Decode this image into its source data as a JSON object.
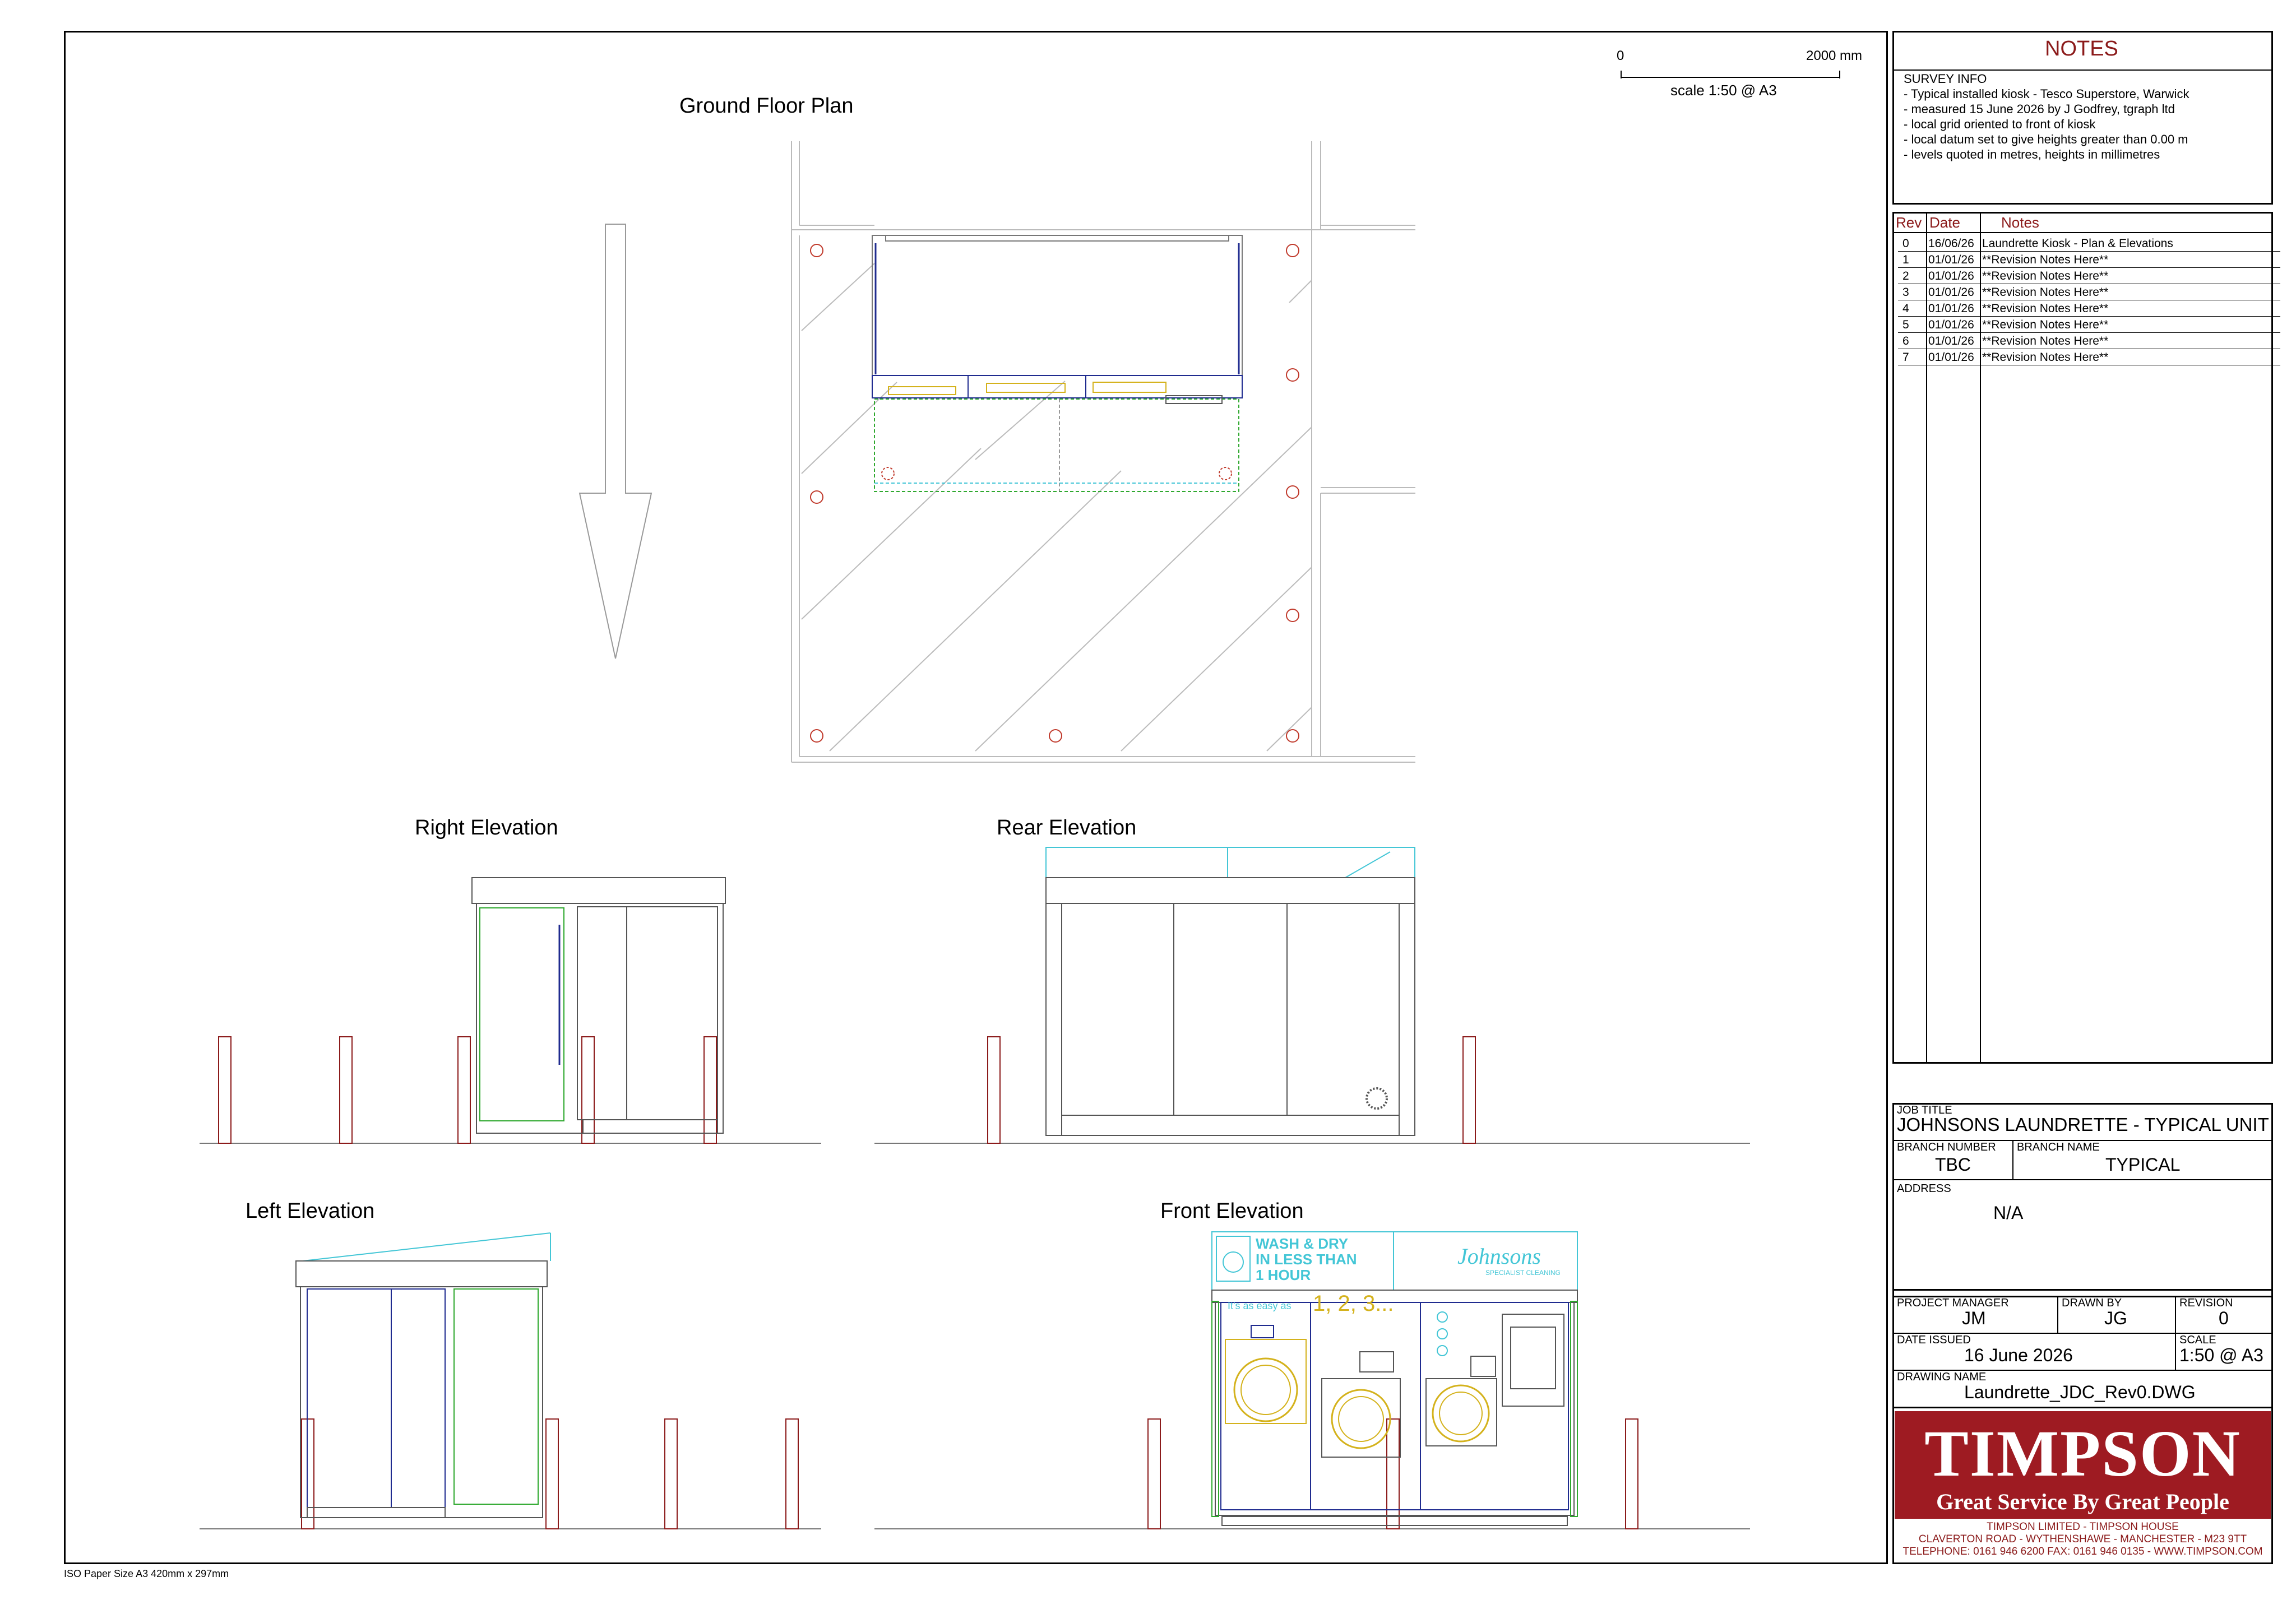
{
  "paper_size": "ISO Paper Size A3 420mm x 297mm",
  "scale_bar": {
    "start": "0",
    "end": "2000 mm",
    "caption": "scale 1:50 @ A3"
  },
  "views": {
    "ground_floor_plan": "Ground Floor Plan",
    "right_elevation": "Right Elevation",
    "rear_elevation": "Rear Elevation",
    "left_elevation": "Left Elevation",
    "front_elevation": "Front Elevation"
  },
  "kiosk_signage": {
    "headline": [
      "WASH & DRY",
      "IN LESS THAN",
      "1 HOUR"
    ],
    "brand": "Johnsons",
    "brand_sub": "SPECIALIST CLEANING",
    "tagline": "It's as easy as",
    "steps": "1, 2, 3..."
  },
  "notes": {
    "heading": "NOTES",
    "survey_info": [
      "SURVEY INFO",
      "- Typical installed kiosk - Tesco Superstore, Warwick",
      "- measured 15 June 2026 by J Godfrey, tgraph ltd",
      "- local grid oriented to front of kiosk",
      "- local datum set to give heights greater than 0.00 m",
      "- levels quoted in metres, heights in millimetres"
    ]
  },
  "revisions": {
    "headers": {
      "rev": "Rev",
      "date": "Date",
      "notes": "Notes"
    },
    "rows": [
      {
        "rev": "0",
        "date": "16/06/26",
        "notes": "Laundrette Kiosk - Plan & Elevations"
      },
      {
        "rev": "1",
        "date": "01/01/26",
        "notes": "**Revision Notes Here**"
      },
      {
        "rev": "2",
        "date": "01/01/26",
        "notes": "**Revision Notes Here**"
      },
      {
        "rev": "3",
        "date": "01/01/26",
        "notes": "**Revision Notes Here**"
      },
      {
        "rev": "4",
        "date": "01/01/26",
        "notes": "**Revision Notes Here**"
      },
      {
        "rev": "5",
        "date": "01/01/26",
        "notes": "**Revision Notes Here**"
      },
      {
        "rev": "6",
        "date": "01/01/26",
        "notes": "**Revision Notes Here**"
      },
      {
        "rev": "7",
        "date": "01/01/26",
        "notes": "**Revision Notes Here**"
      }
    ]
  },
  "title_block": {
    "job_title_label": "JOB TITLE",
    "job_title": "JOHNSONS LAUNDRETTE - TYPICAL UNIT",
    "branch_number_label": "BRANCH NUMBER",
    "branch_number": "TBC",
    "branch_name_label": "BRANCH NAME",
    "branch_name": "TYPICAL",
    "address_label": "ADDRESS",
    "address": "N/A",
    "project_manager_label": "PROJECT MANAGER",
    "project_manager": "JM",
    "drawn_by_label": "DRAWN BY",
    "drawn_by": "JG",
    "revision_label": "REVISION",
    "revision": "0",
    "date_issued_label": "DATE ISSUED",
    "date_issued": "16 June 2026",
    "scale_label": "SCALE",
    "scale": "1:50 @ A3",
    "drawing_name_label": "DRAWING NAME",
    "drawing_name": "Laundrette_JDC_Rev0.DWG"
  },
  "company": {
    "logo": "TIMPSON",
    "slogan": "Great Service By Great People",
    "address_lines": [
      "TIMPSON LIMITED - TIMPSON HOUSE",
      "CLAVERTON ROAD - WYTHENSHAWE - MANCHESTER - M23 9TT",
      "TELEPHONE: 0161 946 6200  FAX: 0161 946 0135 - WWW.TIMPSON.COM"
    ]
  },
  "colors": {
    "red": "#8b1a1a",
    "logo_bg": "#9e1b22",
    "blue": "#1f2b8f",
    "green": "#2ea82e",
    "cyan": "#43c6d6",
    "gold": "#d4b21c",
    "grey": "#b8b8b8"
  }
}
